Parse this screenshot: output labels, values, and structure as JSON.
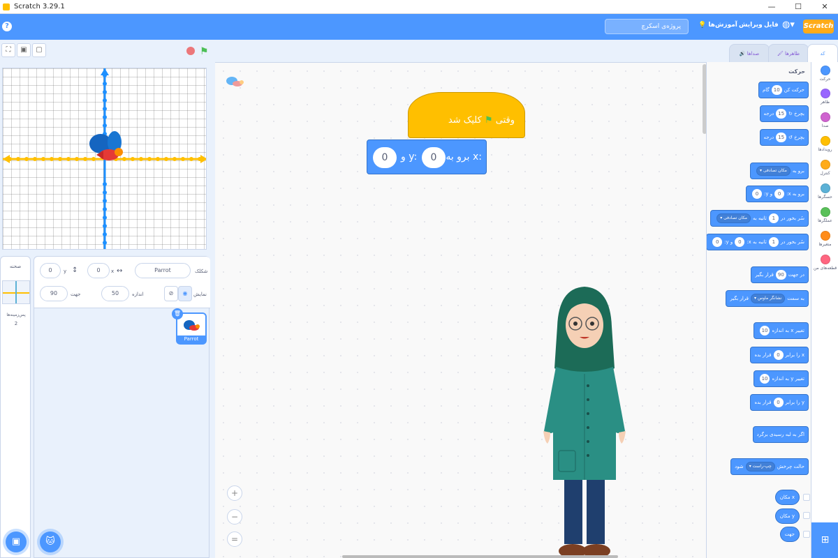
{
  "window": {
    "title": "Scratch 3.29.1",
    "controls": [
      "—",
      "☐",
      "✕"
    ]
  },
  "menubar": {
    "help": "?",
    "project_title_placeholder": "پروژه‌ی اسکرچ",
    "tutorials": "آموزش‌ها",
    "edit": "ویرایش",
    "file": "فایل",
    "logo": "Scratch",
    "accent": "#4c97ff"
  },
  "editor_tabs": {
    "code": "کد",
    "costumes": "ظاهرها",
    "sounds": "صداها"
  },
  "stage_header": {
    "full_screen": "⛶",
    "small_stage": "▣",
    "normal_stage": "▢"
  },
  "categories": [
    {
      "label": "حرکت",
      "color": "#4c97ff"
    },
    {
      "label": "ظاهر",
      "color": "#9966ff"
    },
    {
      "label": "صدا",
      "color": "#cf63cf"
    },
    {
      "label": "رویدادها",
      "color": "#ffbf00"
    },
    {
      "label": "کنترل",
      "color": "#ffab19"
    },
    {
      "label": "حسگرها",
      "color": "#5cb1d6"
    },
    {
      "label": "عملگرها",
      "color": "#59c059"
    },
    {
      "label": "متغیرها",
      "color": "#ff8c1a"
    },
    {
      "label": "قطعه‌های من",
      "color": "#ff6680"
    }
  ],
  "palette": {
    "section_title": "حرکت",
    "blocks": {
      "move": {
        "pre": "حرکت کن",
        "val": "10",
        "post": "گام"
      },
      "turn_right": {
        "pre": "بچرخ ↻",
        "val": "15",
        "post": "درجه"
      },
      "turn_left": {
        "pre": "بچرخ ↺",
        "val": "15",
        "post": "درجه"
      },
      "goto_random": {
        "pre": "برو به",
        "dd": "مکان تصادفی"
      },
      "goto_xy": {
        "pre": "برو به x:",
        "x": "0",
        "mid": "و y:",
        "y": "0"
      },
      "glide_random": {
        "pre": "سُر بخور در",
        "val": "1",
        "mid": "ثانیه به",
        "dd": "مکان تصادفی"
      },
      "glide_xy": {
        "pre": "سُر بخور در",
        "val": "1",
        "mid": "ثانیه به x:",
        "x": "0",
        "mid2": "و y:",
        "y": "0"
      },
      "point_dir": {
        "pre": "در جهت",
        "val": "90",
        "post": "قرار بگیر"
      },
      "point_towards": {
        "pre": "به سمت",
        "dd": "نشانگر ماوس",
        "post": "قرار بگیر"
      },
      "change_x": {
        "pre": "تغییر x به اندازه",
        "val": "10",
        "post": ""
      },
      "set_x": {
        "pre": "x را برابر",
        "val": "0",
        "post": "قرار بده"
      },
      "change_y": {
        "pre": "تغییر y به اندازه",
        "val": "10",
        "post": ""
      },
      "set_y": {
        "pre": "y را برابر",
        "val": "0",
        "post": "قرار بده"
      },
      "bounce": {
        "pre": "اگر به لبه رسیدی برگرد"
      },
      "rotation_style": {
        "pre": "حالت چرخش",
        "dd": "چپ-راست",
        "post": "شود"
      }
    },
    "reporters": {
      "x_pos": "مکان x",
      "y_pos": "مکان y",
      "direction": "جهت"
    }
  },
  "script": {
    "hat": {
      "pre": "وقتی",
      "post": "کلیک شد"
    },
    "goto": {
      "pre": "برو به x:",
      "x": "0",
      "mid": "و y:",
      "y": "0"
    }
  },
  "sprite_info": {
    "sprite_label": "شکلک",
    "sprite_name": "Parrot",
    "x_label": "x",
    "x_value": "0",
    "y_label": "y",
    "y_value": "0",
    "show_label": "نمایش",
    "size_label": "اندازه",
    "size_value": "50",
    "direction_label": "جهت",
    "direction_value": "90"
  },
  "sprite_list": [
    {
      "name": "Parrot"
    }
  ],
  "stage_panel": {
    "title": "صحنه",
    "backdrops_label": "پس‌زمینه‌ها",
    "backdrops_count": "2"
  },
  "code_area": {
    "zoom_in": "+",
    "zoom_out": "−",
    "zoom_reset": "="
  }
}
